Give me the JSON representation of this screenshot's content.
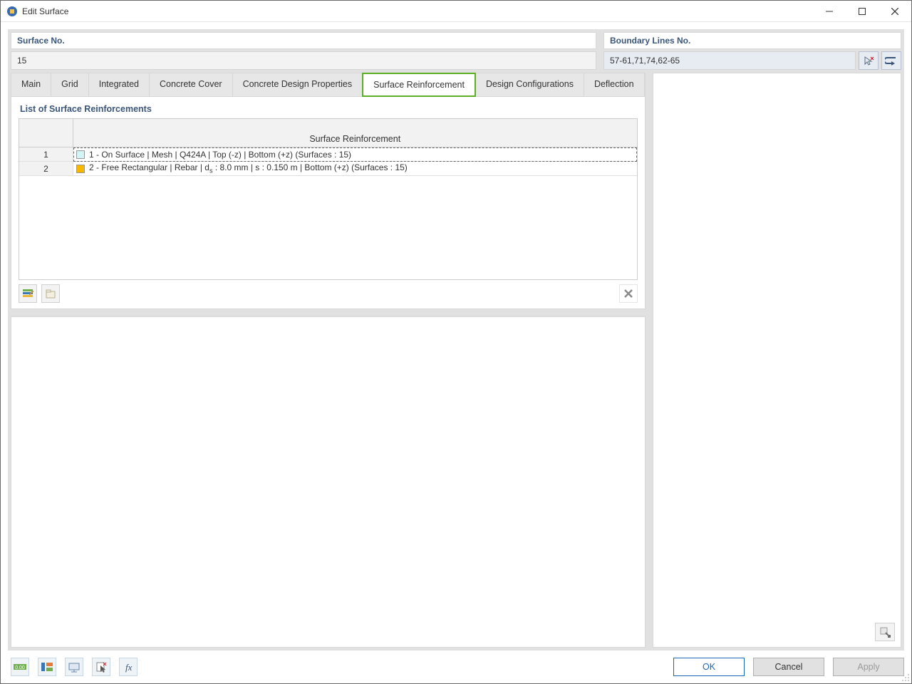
{
  "window": {
    "title": "Edit Surface"
  },
  "header": {
    "left_label": "Surface No.",
    "left_value": "15",
    "right_label": "Boundary Lines No.",
    "right_value": "57-61,71,74,62-65"
  },
  "tabs": [
    {
      "label": "Main"
    },
    {
      "label": "Grid"
    },
    {
      "label": "Integrated"
    },
    {
      "label": "Concrete Cover"
    },
    {
      "label": "Concrete Design Properties"
    },
    {
      "label": "Surface Reinforcement",
      "active": true
    },
    {
      "label": "Design Configurations"
    },
    {
      "label": "Deflection"
    }
  ],
  "section": {
    "title": "List of Surface Reinforcements",
    "column_header": "Surface Reinforcement"
  },
  "rows": [
    {
      "num": "1",
      "swatch": "#d2f4f4",
      "text_pre": "1 - On Surface | Mesh | Q424A | Top (-z) | Bottom (+z) (Surfaces : 15)",
      "text_sub": ""
    },
    {
      "num": "2",
      "swatch": "#f8b700",
      "text_pre": "2 - Free Rectangular | Rebar | d",
      "text_sub": "s",
      "text_post": " : 8.0 mm | s : 0.150 m | Bottom (+z) (Surfaces : 15)"
    }
  ],
  "icons": {
    "minimize": "minimize",
    "maximize": "maximize",
    "close": "close",
    "pick": "pick",
    "reverse": "reverse"
  },
  "footer": {
    "ok": "OK",
    "cancel": "Cancel",
    "apply": "Apply"
  }
}
